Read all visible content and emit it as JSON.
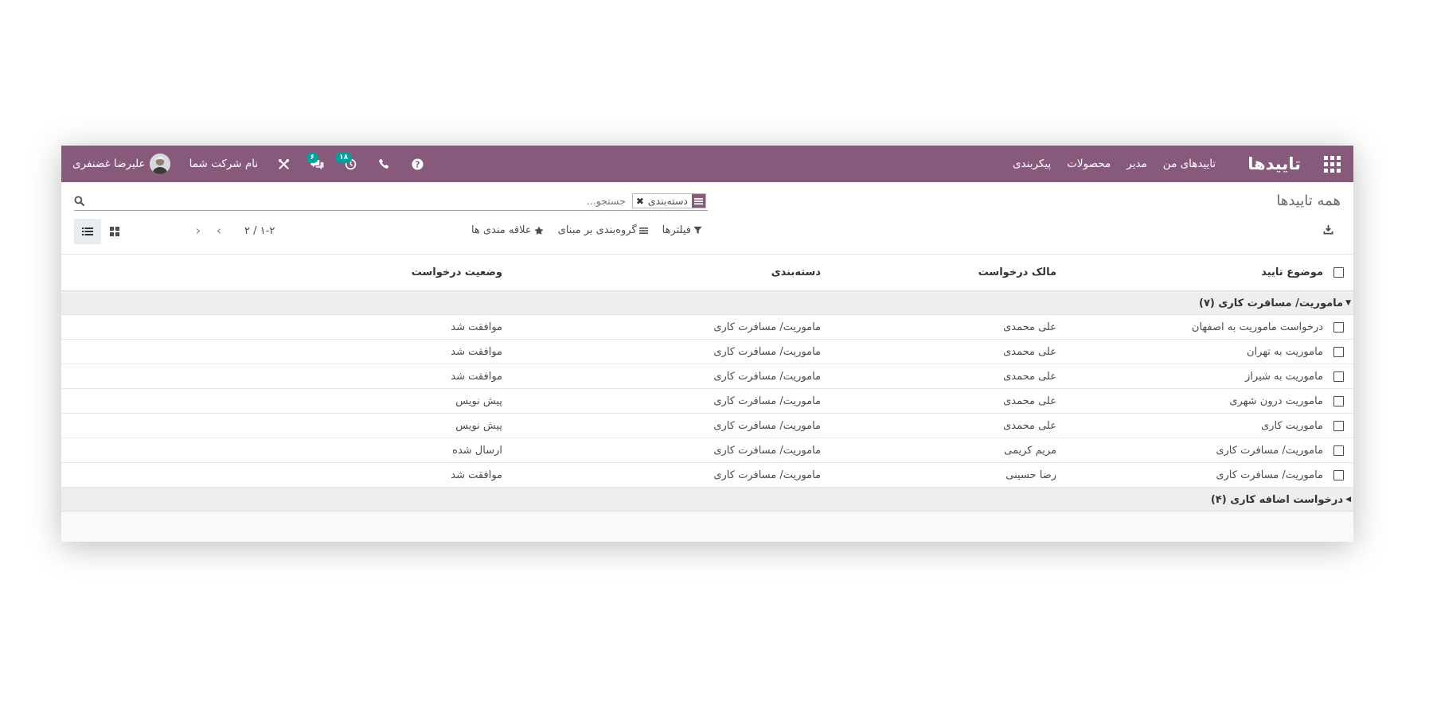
{
  "navbar": {
    "brand": "تاییدها",
    "menu": [
      "تاییدهای من",
      "مدیر",
      "محصولات",
      "پیکربندی"
    ],
    "activity_count": "۱۸",
    "message_count": "۶",
    "company": "نام شرکت شما",
    "user": "علیرضا غضنفری"
  },
  "breadcrumb": "همه تاییدها",
  "search": {
    "facet_value": "دسته‌بندی",
    "placeholder": "جستجو..."
  },
  "search_options": {
    "filters": "فیلترها",
    "group_by": "گروه‌بندی بر مبنای",
    "favorites": "علاقه مندی ها"
  },
  "pager": {
    "value": "۱-۲ / ۲"
  },
  "table": {
    "headers": {
      "subject": "موضوع تایید",
      "owner": "مالک درخواست",
      "category": "دسته‌بندی",
      "state": "وضعیت درخواست"
    },
    "groups": [
      {
        "label": "ماموریت/ مسافرت کاری (۷)",
        "rows": [
          {
            "subject": "درخواست ماموریت به اصفهان",
            "owner": "علی محمدی",
            "category": "ماموریت/ مسافرت کاری",
            "state": "موافقت شد"
          },
          {
            "subject": "ماموریت به تهران",
            "owner": "علی محمدی",
            "category": "ماموریت/ مسافرت کاری",
            "state": "موافقت شد"
          },
          {
            "subject": "ماموریت به شیراز",
            "owner": "علی محمدی",
            "category": "ماموریت/ مسافرت کاری",
            "state": "موافقت شد"
          },
          {
            "subject": "ماموریت درون شهری",
            "owner": "علی محمدی",
            "category": "ماموریت/ مسافرت کاری",
            "state": "پیش نویس"
          },
          {
            "subject": "ماموریت کاری",
            "owner": "علی محمدی",
            "category": "ماموریت/ مسافرت کاری",
            "state": "پیش نویس"
          },
          {
            "subject": "ماموریت/ مسافرت کاری",
            "owner": "مریم کریمی",
            "category": "ماموریت/ مسافرت کاری",
            "state": "ارسال شده"
          },
          {
            "subject": "ماموریت/ مسافرت کاری",
            "owner": "رضا حسینی",
            "category": "ماموریت/ مسافرت کاری",
            "state": "موافقت شد"
          }
        ]
      },
      {
        "label": "درخواست اضافه کاری (۴)",
        "rows": []
      }
    ]
  }
}
